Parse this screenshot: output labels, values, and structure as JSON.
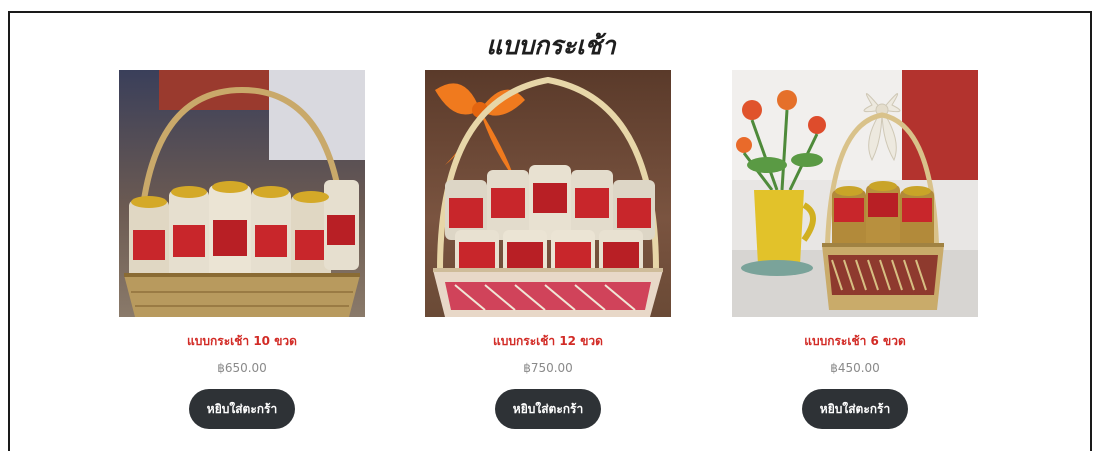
{
  "section": {
    "title": "แบบกระเช้า"
  },
  "products": [
    {
      "name": "แบบกระเช้า 10 ขวด",
      "price": "฿650.00",
      "button_label": "หยิบใส่ตะกร้า",
      "image_alt": "basket-10-bottles-photo"
    },
    {
      "name": "แบบกระเช้า 12 ขวด",
      "price": "฿750.00",
      "button_label": "หยิบใส่ตะกร้า",
      "image_alt": "basket-12-bottles-photo"
    },
    {
      "name": "แบบกระเช้า 6 ขวด",
      "price": "฿450.00",
      "button_label": "หยิบใส่ตะกร้า",
      "image_alt": "basket-6-bottles-photo"
    }
  ],
  "colors": {
    "product_name": "#d22b26",
    "price": "#8a8a8a",
    "button_bg": "#2e3236",
    "button_text": "#ffffff"
  }
}
